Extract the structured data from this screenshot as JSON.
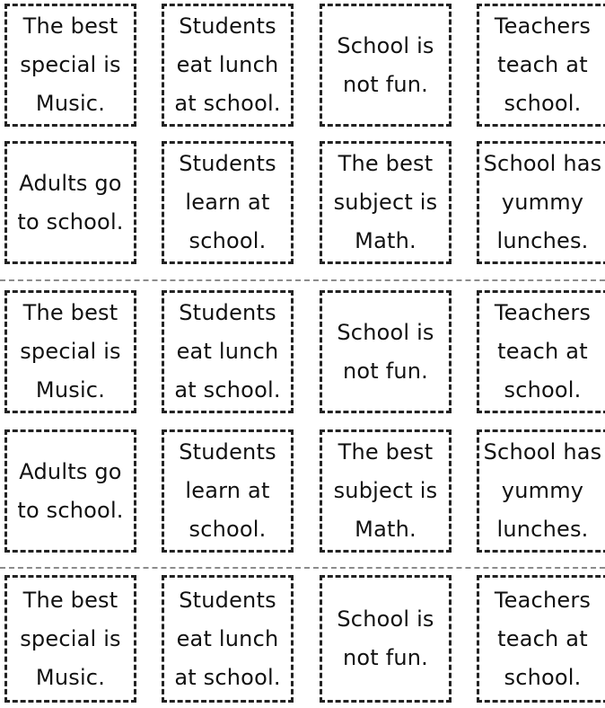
{
  "rows": [
    [
      "The best special is Music.",
      "Students eat lunch at school.",
      "School is not fun.",
      "Teachers teach at school."
    ],
    [
      "Adults go to school.",
      "Students learn at school.",
      "The best subject is Math.",
      "School has yummy lunches."
    ],
    [
      "The best special is Music.",
      "Students eat lunch at school.",
      "School is not fun.",
      "Teachers teach at school."
    ],
    [
      "Adults go to school.",
      "Students learn at school.",
      "The best subject is Math.",
      "School has yummy lunches."
    ],
    [
      "The best special is Music.",
      "Students eat lunch at school.",
      "School is not fun.",
      "Teachers teach at school."
    ]
  ],
  "card_lines": {
    "The best special is Music.": [
      "The best",
      "special is",
      "Music."
    ],
    "Students eat lunch at school.": [
      "Students",
      "eat lunch",
      "at school."
    ],
    "School is not fun.": [
      "School is",
      "not fun."
    ],
    "Teachers teach at school.": [
      "Teachers",
      "teach at",
      "school."
    ],
    "Adults go to school.": [
      "Adults go",
      "to school."
    ],
    "Students learn at school.": [
      "Students",
      "learn at",
      "school."
    ],
    "The best subject is Math.": [
      "The best",
      "subject is",
      "Math."
    ],
    "School has yummy lunches.": [
      "School has",
      "yummy",
      "lunches."
    ]
  }
}
